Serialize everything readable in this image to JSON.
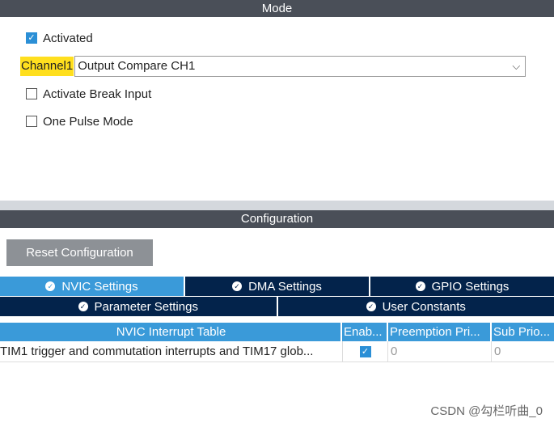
{
  "mode": {
    "header": "Mode",
    "activated": {
      "label": "Activated",
      "checked": true
    },
    "channel": {
      "label": "Channel1",
      "value": "Output Compare CH1"
    },
    "break_input": {
      "label": "Activate Break Input",
      "checked": false
    },
    "one_pulse": {
      "label": "One Pulse Mode",
      "checked": false
    }
  },
  "configuration": {
    "header": "Configuration",
    "reset_label": "Reset Configuration",
    "tabs_row1": [
      {
        "label": "NVIC Settings",
        "active": true,
        "icon": "check-circle-icon"
      },
      {
        "label": "DMA Settings",
        "active": false,
        "icon": "check-circle-icon"
      },
      {
        "label": "GPIO Settings",
        "active": false,
        "icon": "check-circle-icon"
      }
    ],
    "tabs_row2": [
      {
        "label": "Parameter Settings",
        "active": false,
        "icon": "check-circle-icon"
      },
      {
        "label": "User Constants",
        "active": false,
        "icon": "check-circle-icon"
      }
    ],
    "table": {
      "headers": [
        "NVIC Interrupt Table",
        "Enab...",
        "Preemption Pri...",
        "Sub Prio..."
      ],
      "rows": [
        {
          "name": "TIM1 trigger and commutation interrupts and TIM17 glob...",
          "enabled": true,
          "preemption": "0",
          "sub": "0"
        }
      ]
    }
  },
  "watermark": "CSDN @勾栏听曲_0",
  "colors": {
    "header_bg": "#4a4f58",
    "tab_bg": "#03234b",
    "tab_active": "#3a9ad9",
    "highlight": "#ffdf1e"
  }
}
